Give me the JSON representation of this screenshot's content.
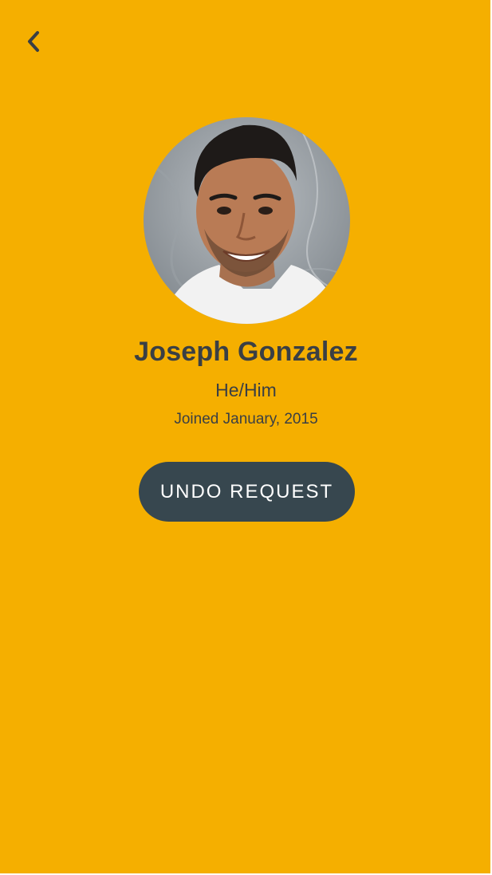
{
  "header": {
    "back_icon": "chevron-left-icon"
  },
  "profile": {
    "avatar_icon": "profile-photo",
    "name": "Joseph Gonzalez",
    "pronouns": "He/Him",
    "joined": "Joined January, 2015"
  },
  "actions": {
    "undo_label": "UNDO REQUEST"
  },
  "colors": {
    "background": "#F5AF00",
    "text": "#3A3F44",
    "button": "#37474F",
    "button_text": "#FFFFFF"
  }
}
